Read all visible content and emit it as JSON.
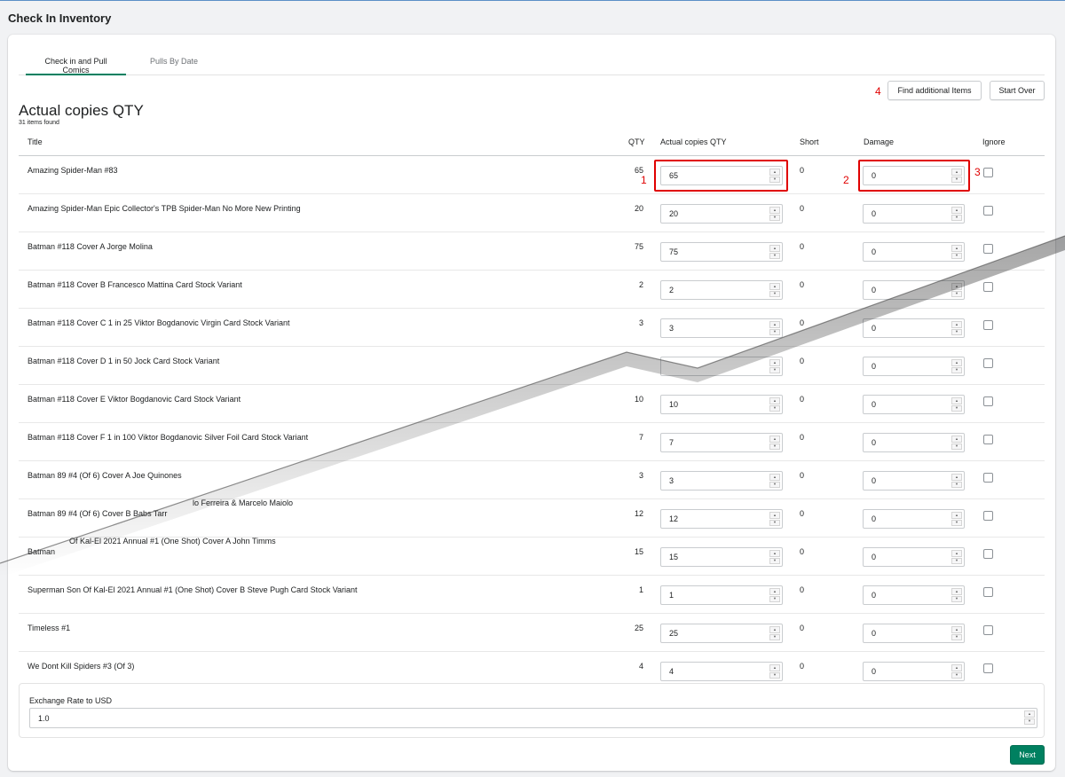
{
  "page": {
    "title": "Check In Inventory"
  },
  "tabs": [
    {
      "label": "Check in and Pull Comics",
      "active": true
    },
    {
      "label": "Pulls By Date",
      "active": false
    }
  ],
  "actions": {
    "find_label": "Find additional Items",
    "start_over_label": "Start Over",
    "next_label": "Next"
  },
  "annotations": {
    "n1": "1",
    "n2": "2",
    "n3": "3",
    "n4": "4"
  },
  "section": {
    "title": "Actual copies QTY",
    "count_text": "31 items found"
  },
  "table": {
    "headers": {
      "title": "Title",
      "qty": "QTY",
      "actual": "Actual copies QTY",
      "short": "Short",
      "damage": "Damage",
      "ignore": "Ignore"
    },
    "rows": [
      {
        "title": "Amazing Spider-Man #83",
        "qty": "65",
        "actual": "65",
        "short": "0",
        "damage": "0"
      },
      {
        "title": "Amazing Spider-Man Epic Collector's TPB Spider-Man No More New Printing",
        "qty": "20",
        "actual": "20",
        "short": "0",
        "damage": "0"
      },
      {
        "title": "Batman #118 Cover A Jorge Molina",
        "qty": "75",
        "actual": "75",
        "short": "0",
        "damage": "0"
      },
      {
        "title": "Batman #118 Cover B Francesco Mattina Card Stock Variant",
        "qty": "2",
        "actual": "2",
        "short": "0",
        "damage": "0"
      },
      {
        "title": "Batman #118 Cover C 1 in 25 Viktor Bogdanovic Virgin Card Stock Variant",
        "qty": "3",
        "actual": "3",
        "short": "0",
        "damage": "0"
      },
      {
        "title": "Batman #118 Cover D 1 in 50 Jock Card Stock Variant",
        "qty": "",
        "actual": "",
        "short": "0",
        "damage": "0"
      },
      {
        "title": "Batman #118 Cover E Viktor Bogdanovic Card Stock Variant",
        "qty": "10",
        "actual": "10",
        "short": "0",
        "damage": "0"
      },
      {
        "title": "Batman #118 Cover F 1 in 100 Viktor Bogdanovic Silver Foil Card Stock Variant",
        "qty": "7",
        "actual": "7",
        "short": "0",
        "damage": "0"
      },
      {
        "title": "Batman 89 #4 (Of 6) Cover A Joe Quinones",
        "qty": "3",
        "actual": "3",
        "short": "0",
        "damage": "0"
      },
      {
        "title": "Batman 89 #4 (Of 6) Cover B Babs Tarr",
        "qty": "12",
        "actual": "12",
        "short": "0",
        "damage": "0"
      },
      {
        "title": "Batman",
        "qty": "15",
        "actual": "15",
        "short": "0",
        "damage": "0"
      },
      {
        "title": "Superman Son Of Kal-El 2021 Annual #1 (One Shot) Cover B Steve Pugh Card Stock Variant",
        "qty": "1",
        "actual": "1",
        "short": "0",
        "damage": "0"
      },
      {
        "title": "Timeless #1",
        "qty": "25",
        "actual": "25",
        "short": "0",
        "damage": "0"
      },
      {
        "title": "We Dont Kill Spiders #3 (Of 3)",
        "qty": "4",
        "actual": "4",
        "short": "0",
        "damage": "0"
      }
    ],
    "fragments": {
      "ferreira": "lo Ferreira & Marcelo Maiolo",
      "kalel": "Of Kal-El 2021 Annual #1 (One Shot) Cover A John Timms"
    }
  },
  "exchange": {
    "label": "Exchange Rate to USD",
    "value": "1.0"
  },
  "colors": {
    "accent": "#008060",
    "highlight": "#e00000"
  },
  "icons": {
    "spin_up": "▲",
    "spin_down": "▼"
  }
}
